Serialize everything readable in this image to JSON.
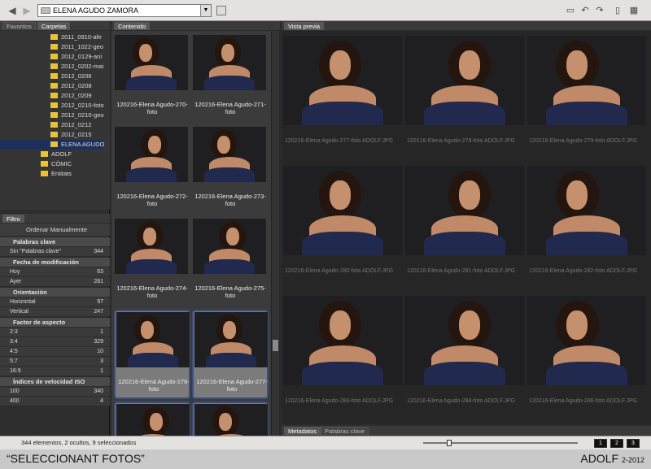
{
  "toolbar": {
    "back_icon": "left-arrow-icon",
    "forward_icon": "right-arrow-icon",
    "path": "ELENA AGUDO ZAMORA"
  },
  "left_panel": {
    "tabs": [
      "Favoritos",
      "Carpetas"
    ],
    "folders": [
      {
        "name": "2011_0910-afe",
        "indent": 1,
        "selected": false
      },
      {
        "name": "2011_1022-geo",
        "indent": 1,
        "selected": false
      },
      {
        "name": "2012_0129-ani",
        "indent": 1,
        "selected": false
      },
      {
        "name": "2012_0202-mai",
        "indent": 1,
        "selected": false
      },
      {
        "name": "2012_0206",
        "indent": 1,
        "selected": false
      },
      {
        "name": "2012_0208",
        "indent": 1,
        "selected": false
      },
      {
        "name": "2012_0209",
        "indent": 1,
        "selected": false
      },
      {
        "name": "2012_0210-foto",
        "indent": 1,
        "selected": false
      },
      {
        "name": "2012_0210-geo",
        "indent": 1,
        "selected": false
      },
      {
        "name": "2012_0212",
        "indent": 1,
        "selected": false
      },
      {
        "name": "2012_0215",
        "indent": 1,
        "selected": false
      },
      {
        "name": "ELENA AGUDO",
        "indent": 1,
        "selected": true
      },
      {
        "name": "ADOLF",
        "indent": 0,
        "selected": false
      },
      {
        "name": "CÒMIC",
        "indent": 0,
        "selected": false
      },
      {
        "name": "Entitats",
        "indent": 0,
        "selected": false
      }
    ],
    "filter_tab": "Filtro",
    "sort_label": "Ordenar Manualmente",
    "filter_sections": [
      {
        "title": "Palabras clave",
        "rows": [
          {
            "label": "Sin \"Palabras clave\"",
            "count": "344"
          }
        ]
      },
      {
        "title": "Fecha de modificación",
        "rows": [
          {
            "label": "Hoy",
            "count": "63"
          },
          {
            "label": "Ayer",
            "count": "281"
          }
        ]
      },
      {
        "title": "Orientación",
        "rows": [
          {
            "label": "Horizontal",
            "count": "97"
          },
          {
            "label": "Vertical",
            "count": "247"
          }
        ]
      },
      {
        "title": "Factor de aspecto",
        "rows": [
          {
            "label": "2:3",
            "count": "1"
          },
          {
            "label": "3:4",
            "count": "329"
          },
          {
            "label": "4:5",
            "count": "10"
          },
          {
            "label": "5:7",
            "count": "3"
          },
          {
            "label": "16:9",
            "count": "1"
          }
        ]
      },
      {
        "title": "Índices de velocidad ISO",
        "rows": [
          {
            "label": "100",
            "count": "340"
          },
          {
            "label": "400",
            "count": "4"
          }
        ]
      }
    ]
  },
  "content_panel": {
    "tab": "Contenido",
    "thumbnails": [
      {
        "label": "120216-Elena Agudo-270-foto",
        "selected": false
      },
      {
        "label": "120216-Elena Agudo-271-foto",
        "selected": false
      },
      {
        "label": "120216-Elena Agudo-272-foto",
        "selected": false
      },
      {
        "label": "120216-Elena Agudo-273-foto",
        "selected": false
      },
      {
        "label": "120216-Elena Agudo-274-foto",
        "selected": false
      },
      {
        "label": "120216-Elena Agudo-275-foto",
        "selected": false
      },
      {
        "label": "120216-Elena Agudo-276-foto",
        "selected": true
      },
      {
        "label": "120216-Elena Agudo-277-foto",
        "selected": true
      },
      {
        "label": "",
        "selected": true
      },
      {
        "label": "",
        "selected": true
      }
    ]
  },
  "preview_panel": {
    "tab": "Vista previa",
    "images": [
      "120216-Elena Agudo-277-foto ADOLF.JPG",
      "120216-Elena Agudo-278-foto ADOLF.JPG",
      "120216-Elena Agudo-279-foto ADOLF.JPG",
      "120216-Elena Agudo-280-foto ADOLF.JPG",
      "120216-Elena Agudo-281-foto ADOLF.JPG",
      "120216-Elena Agudo-282-foto ADOLF.JPG",
      "120216-Elena Agudo-283-foto ADOLF.JPG",
      "120216-Elena Agudo-284-foto ADOLF.JPG",
      "120216-Elena Agudo-286-foto ADOLF.JPG"
    ],
    "bottom_tabs": [
      "Metadatos",
      "Palabras clave"
    ]
  },
  "status": {
    "text": "344 elementos, 2 ocultos, 9 seleccionados",
    "zoom_level": 0.15,
    "view_buttons": [
      "1",
      "2",
      "3"
    ]
  },
  "caption": {
    "left": "“SELECCIONANT FOTOS”",
    "right_main": "ADOLF",
    "right_small": "2-2012"
  },
  "colors": {
    "selection": "#1d2f5c",
    "thumb_selected_border": "#3a4f86",
    "cloth": "#212a4e"
  }
}
